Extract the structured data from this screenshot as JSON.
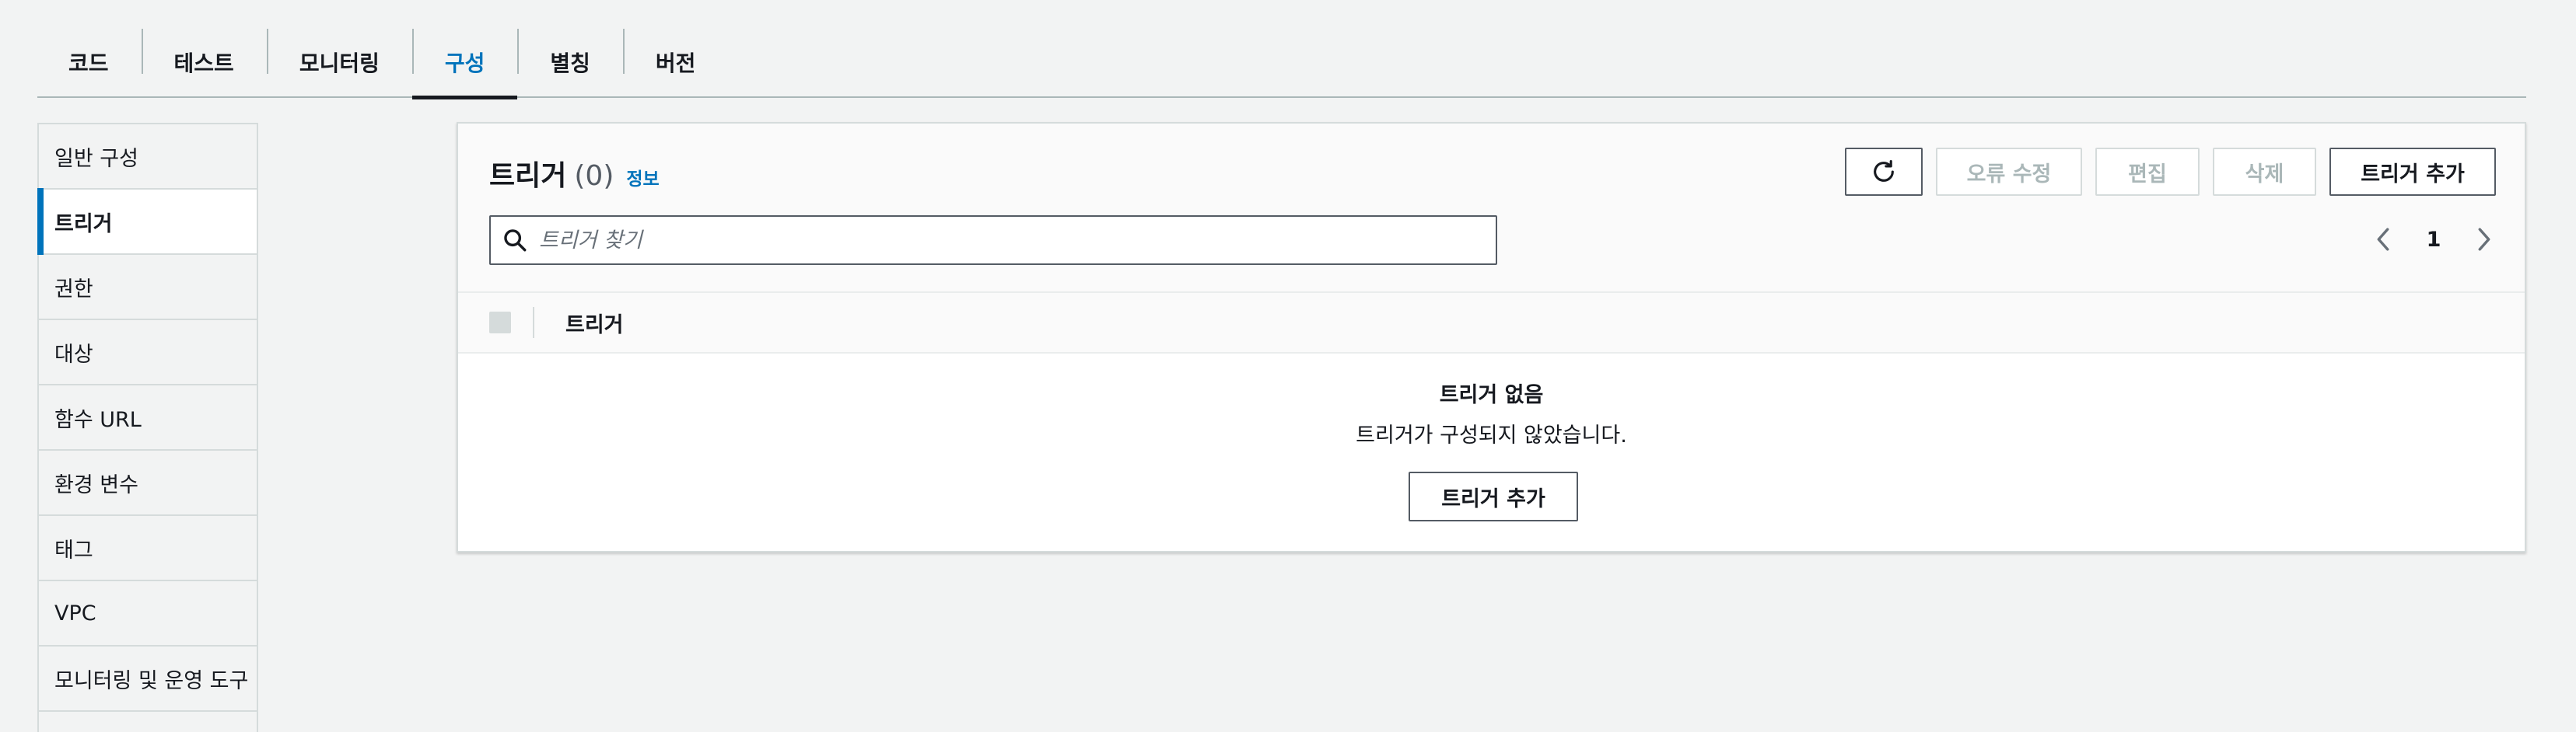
{
  "tabs": [
    {
      "label": "코드"
    },
    {
      "label": "테스트"
    },
    {
      "label": "모니터링"
    },
    {
      "label": "구성",
      "active": true
    },
    {
      "label": "별칭"
    },
    {
      "label": "버전"
    }
  ],
  "sidebar": {
    "items": [
      {
        "label": "일반 구성"
      },
      {
        "label": "트리거",
        "active": true
      },
      {
        "label": "권한"
      },
      {
        "label": "대상"
      },
      {
        "label": "함수 URL"
      },
      {
        "label": "환경 변수"
      },
      {
        "label": "태그"
      },
      {
        "label": "VPC"
      },
      {
        "label": "모니터링 및 운영 도구"
      }
    ]
  },
  "triggers": {
    "title": "트리거",
    "count": "(0)",
    "info_link": "정보",
    "buttons": {
      "refresh_icon": "refresh-icon",
      "fix_errors": "오류 수정",
      "edit": "편집",
      "delete": "삭제",
      "add": "트리거 추가"
    },
    "search": {
      "placeholder": "트리거 찾기",
      "value": ""
    },
    "pagination": {
      "current_page": "1"
    },
    "table": {
      "columns": [
        "트리거"
      ]
    },
    "empty_state": {
      "title": "트리거 없음",
      "description": "트리거가 구성되지 않았습니다.",
      "button": "트리거 추가"
    }
  },
  "colors": {
    "accent": "#0073bb",
    "text": "#16191f",
    "disabled": "#aab7b8",
    "border": "#d5dbdb",
    "background": "#f2f3f3"
  }
}
